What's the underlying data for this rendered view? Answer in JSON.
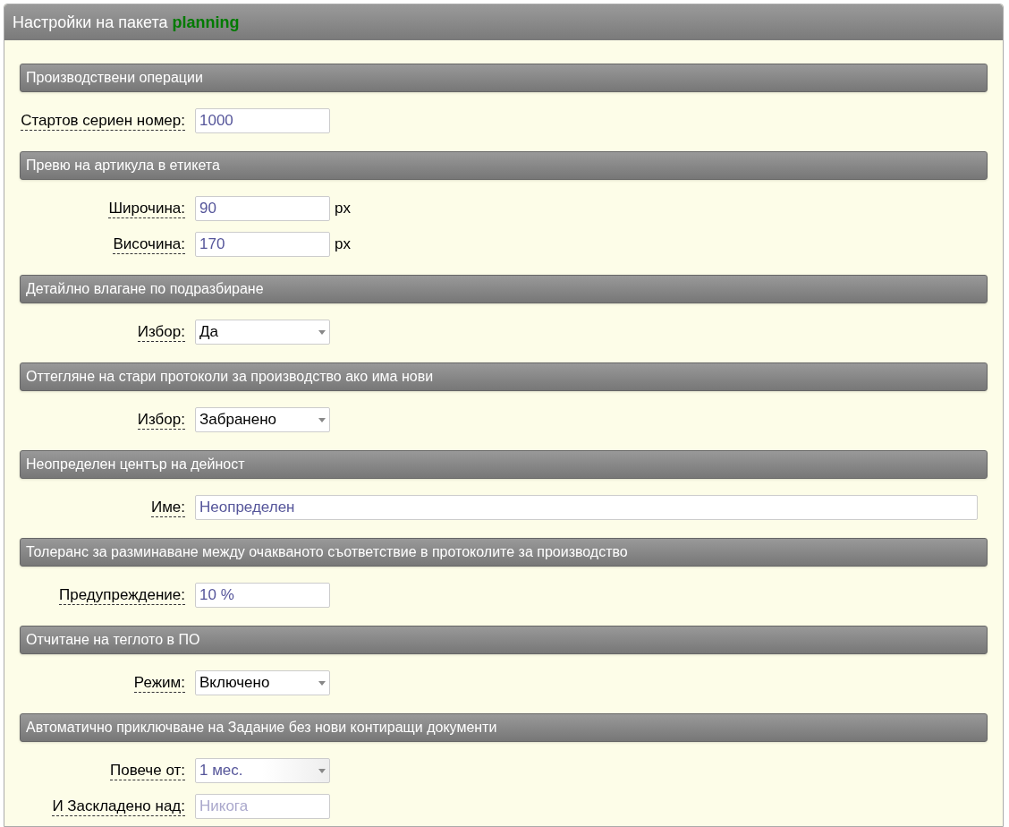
{
  "panel": {
    "title": "Настройки на пакета **planning**"
  },
  "sections": [
    {
      "title": "Производствени операции",
      "fields": [
        {
          "label": "Стартов сериен номер:",
          "kind": "text",
          "value": "1000"
        }
      ]
    },
    {
      "title": "Превю на артикула в етикета",
      "fields": [
        {
          "label": "Широчина:",
          "kind": "text",
          "value": "90",
          "unit": "px"
        },
        {
          "label": "Височина:",
          "kind": "text",
          "value": "170",
          "unit": "px"
        }
      ]
    },
    {
      "title": "Детайлно влагане по подразбиране",
      "fields": [
        {
          "label": "Избор:",
          "kind": "select",
          "value": "Да"
        }
      ]
    },
    {
      "title": "Оттегляне на стари протоколи за производство ако има нови",
      "fields": [
        {
          "label": "Избор:",
          "kind": "select",
          "value": "Забранено"
        }
      ]
    },
    {
      "title": "Неопределен център на дейност",
      "fields": [
        {
          "label": "Име:",
          "kind": "wide",
          "value": "Неопределен"
        }
      ]
    },
    {
      "title": "Толеранс за разминаване между очакваното съответствие в протоколите за производство",
      "fields": [
        {
          "label": "Предупреждение:",
          "kind": "text",
          "value": "10 %"
        }
      ]
    },
    {
      "title": "Отчитане на теглото в ПО",
      "fields": [
        {
          "label": "Режим:",
          "kind": "select",
          "value": "Включено"
        }
      ]
    },
    {
      "title": "Автоматично приключване на Задание без нови контиращи документи",
      "fields": [
        {
          "label": "Повече от:",
          "kind": "combo",
          "value": "1 мес."
        },
        {
          "label": "И Заскладено над:",
          "kind": "text",
          "placeholder": "Никога"
        }
      ]
    }
  ]
}
